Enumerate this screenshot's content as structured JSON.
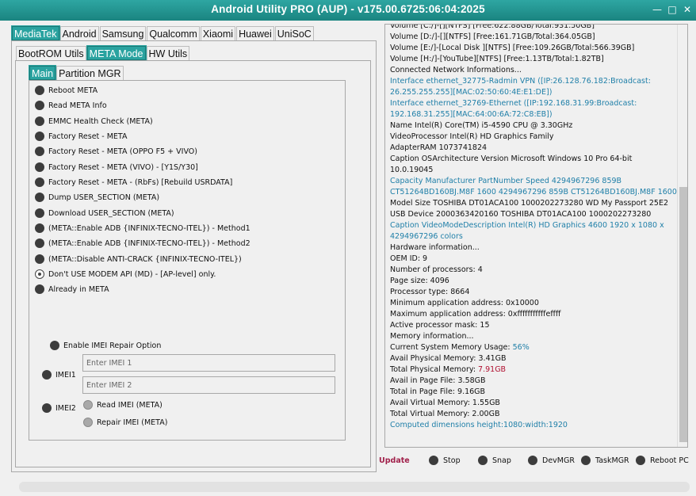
{
  "window": {
    "title": "Android Utility PRO (AUP) - v175.00.6725:06:04:2025",
    "controls": {
      "minimize": "—",
      "maximize": "□",
      "close": "✕"
    }
  },
  "brand_tabs": [
    {
      "label": "MediaTek",
      "active": true
    },
    {
      "label": "Android",
      "active": false
    },
    {
      "label": "Samsung",
      "active": false
    },
    {
      "label": "Qualcomm",
      "active": false
    },
    {
      "label": "Xiaomi",
      "active": false
    },
    {
      "label": "Huawei",
      "active": false
    },
    {
      "label": "UniSoC",
      "active": false
    }
  ],
  "mode_tabs": [
    {
      "label": "BootROM Utils",
      "active": false
    },
    {
      "label": "META Mode",
      "active": true
    },
    {
      "label": "HW Utils",
      "active": false
    }
  ],
  "sub_tabs": [
    {
      "label": "Main",
      "active": true
    },
    {
      "label": "Partition MGR",
      "active": false
    }
  ],
  "options": [
    {
      "label": "Reboot META",
      "style": "dot"
    },
    {
      "label": "Read META Info",
      "style": "dot"
    },
    {
      "label": "EMMC Health Check (META)",
      "style": "dot"
    },
    {
      "label": "Factory Reset - META",
      "style": "dot"
    },
    {
      "label": "Factory Reset - META (OPPO F5 + VIVO)",
      "style": "dot"
    },
    {
      "label": "Factory Reset - META (VIVO) - [Y1S/Y30]",
      "style": "dot"
    },
    {
      "label": "Factory Reset - META - (RbFs) [Rebuild USRDATA]",
      "style": "dot"
    },
    {
      "label": "Dump  USER_SECTION (META)",
      "style": "dot"
    },
    {
      "label": "Download  USER_SECTION (META)",
      "style": "dot"
    },
    {
      "label": "(META::Enable ADB {INFINIX-TECNO-ITEL}) - Method1",
      "style": "dot"
    },
    {
      "label": "(META::Enable ADB {INFINIX-TECNO-ITEL}) - Method2",
      "style": "dot"
    },
    {
      "label": "(META::Disable ANTI-CRACK {INFINIX-TECNO-ITEL})",
      "style": "dot"
    },
    {
      "label": "Don't USE MODEM API (MD) - [AP-level] only.",
      "style": "radio"
    },
    {
      "label": "Already in META",
      "style": "dot"
    }
  ],
  "imei": {
    "enable_label": "Enable IMEI Repair Option",
    "imei1_label": "IMEI1",
    "imei2_label": "IMEI2",
    "imei1_placeholder": "Enter IMEI 1",
    "imei2_placeholder": "Enter IMEI 2",
    "read_label": "Read IMEI (META)",
    "repair_label": "Repair IMEI (META)"
  },
  "log_lines": [
    {
      "text": "Volume [C:/]-[][NTFS] [Free:622.88GB/Total:931.50GB]",
      "color": "#111111",
      "wrap": false
    },
    {
      "text": "Volume [D:/]-[][NTFS] [Free:161.71GB/Total:364.05GB]",
      "color": "#111111",
      "wrap": false
    },
    {
      "text": "Volume [E:/]-[Local Disk ][NTFS] [Free:109.26GB/Total:566.39GB]",
      "color": "#111111",
      "wrap": false
    },
    {
      "text": "Volume [H:/]-[YouTube][NTFS] [Free:1.13TB/Total:1.82TB]",
      "color": "#111111",
      "wrap": false
    },
    {
      "text": "Connected Network Informations...",
      "color": "#111111",
      "wrap": false
    },
    {
      "text": "Interface ethernet_32775-Radmin VPN ([IP:26.128.76.182:Broadcast: 26.255.255.255][MAC:02:50:60:4E:E1:DE])",
      "color": "#1f7fa8",
      "wrap": true
    },
    {
      "text": "Interface ethernet_32769-Ethernet ([IP:192.168.31.99:Broadcast: 192.168.31.255][MAC:64:00:6A:72:C8:EB])",
      "color": "#1f7fa8",
      "wrap": true
    },
    {
      "text": "Name Intel(R) Core(TM) i5-4590 CPU @ 3.30GHz",
      "color": "#111111",
      "wrap": false
    },
    {
      "text": "VideoProcessor Intel(R) HD Graphics Family",
      "color": "#111111",
      "wrap": false
    },
    {
      "text": "AdapterRAM 1073741824",
      "color": "#111111",
      "wrap": false
    },
    {
      "text": "Caption OSArchitecture Version Microsoft Windows 10 Pro 64-bit 10.0.19045",
      "color": "#111111",
      "wrap": true
    },
    {
      "text": "Capacity Manufacturer PartNumber Speed 4294967296 859B CT51264BD160BJ.M8F 1600 4294967296 859B CT51264BD160BJ.M8F 1600",
      "color": "#1f7fa8",
      "wrap": true
    },
    {
      "text": "Model Size TOSHIBA DT01ACA100 1000202273280 WD My Passport 25E2",
      "color": "#111111",
      "wrap": false
    },
    {
      "text": "USB Device 2000363420160 TOSHIBA DT01ACA100 1000202273280",
      "color": "#111111",
      "wrap": false
    },
    {
      "text": "Caption VideoModeDescription Intel(R) HD Graphics 4600 1920 x 1080 x 4294967296 colors",
      "color": "#1f7fa8",
      "wrap": true
    },
    {
      "text": "Hardware information...",
      "color": "#111111",
      "wrap": false
    },
    {
      "text": "OEM ID: 9",
      "color": "#111111",
      "wrap": false
    },
    {
      "text": "Number of processors: 4",
      "color": "#111111",
      "wrap": false
    },
    {
      "text": "Page size: 4096",
      "color": "#111111",
      "wrap": false
    },
    {
      "text": "Processor type: 8664",
      "color": "#111111",
      "wrap": false
    },
    {
      "text": "Minimum application address: 0x10000",
      "color": "#111111",
      "wrap": false
    },
    {
      "text": "Maximum application address: 0xfffffffffffeffff",
      "color": "#111111",
      "wrap": false
    },
    {
      "text": "Active processor mask: 15",
      "color": "#111111",
      "wrap": false
    },
    {
      "text": "Memory information...",
      "color": "#111111",
      "wrap": false
    },
    {
      "text": "Current System Memory Usage: ",
      "color": "#111111",
      "wrap": false,
      "suffix": "56%",
      "suffix_color": "#1f7fa8"
    },
    {
      "text": "Avail Physical Memory: 3.41GB",
      "color": "#111111",
      "wrap": false
    },
    {
      "text": "Total Physical Memory: ",
      "color": "#111111",
      "wrap": false,
      "suffix": "7.91GB",
      "suffix_color": "#b01030"
    },
    {
      "text": "Avail in Page File: 3.58GB",
      "color": "#111111",
      "wrap": false
    },
    {
      "text": "Total in Page File: 9.16GB",
      "color": "#111111",
      "wrap": false
    },
    {
      "text": "Avail Virtual Memory: 1.55GB",
      "color": "#111111",
      "wrap": false
    },
    {
      "text": "Total Virtual Memory: 2.00GB",
      "color": "#111111",
      "wrap": false
    },
    {
      "text": "Computed dimensions height:1080:width:1920",
      "color": "#1f7fa8",
      "wrap": false
    }
  ],
  "bottom": {
    "update_label": "Update",
    "buttons": [
      "Stop",
      "Snap",
      "DevMGR",
      "TaskMGR",
      "Reboot PC"
    ]
  },
  "colors": {
    "accent": "#2aa3a0",
    "link": "#1f7fa8",
    "warn": "#b01030",
    "update": "#a0204a"
  }
}
